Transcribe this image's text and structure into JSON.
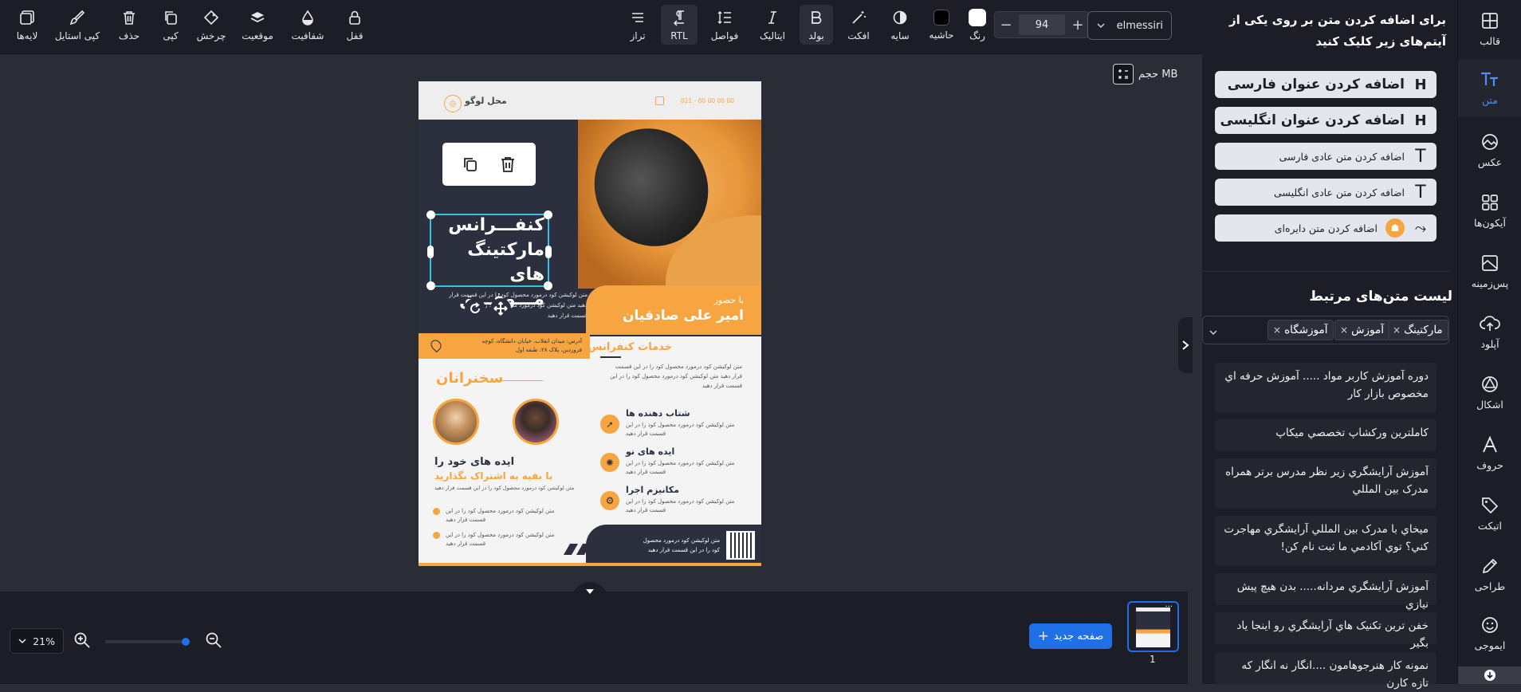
{
  "toolbar": {
    "font_name": "elmessiri",
    "font_size": "94",
    "minus": "−",
    "plus": "+",
    "items": {
      "color": "رنگ",
      "border": "حاشیه",
      "shadow": "سایه",
      "effect": "افکت",
      "bold": "بولد",
      "italic": "ایتالیک",
      "spacing": "فواصل",
      "rtl": "RTL",
      "align": "تراز",
      "lock": "قفل",
      "opacity": "شفافیت",
      "position": "موقعیت",
      "rotate": "چرخش",
      "copy": "کپی",
      "delete": "حذف",
      "copy_style": "کپی استایل",
      "layers": "لایه‌ها"
    }
  },
  "sidebar": {
    "items": [
      {
        "label": "قالب",
        "icon": "template-icon"
      },
      {
        "label": "متن",
        "icon": "text-icon"
      },
      {
        "label": "عکس",
        "icon": "image-icon"
      },
      {
        "label": "آیکون‌ها",
        "icon": "icons-grid-icon"
      },
      {
        "label": "پس‌زمینه",
        "icon": "background-icon"
      },
      {
        "label": "آپلود",
        "icon": "upload-icon"
      },
      {
        "label": "اشکال",
        "icon": "shapes-icon"
      },
      {
        "label": "حروف",
        "icon": "letters-icon"
      },
      {
        "label": "اتیکت",
        "icon": "tag-icon"
      },
      {
        "label": "طراحی",
        "icon": "draw-icon"
      },
      {
        "label": "ایموجی",
        "icon": "emoji-icon"
      }
    ]
  },
  "panel": {
    "instruction": "برای اضافه کردن متن بر روی یکی از آیتم‌های زیر کلیک کنید",
    "add_buttons": [
      {
        "label": "اضافه کردن عنوان فارسی",
        "glyph": "H"
      },
      {
        "label": "اضافه کردن عنوان انگلیسی",
        "glyph": "H"
      },
      {
        "label": "اضافه کردن متن عادی فارسی",
        "glyph": "T"
      },
      {
        "label": "اضافه کردن متن عادی انگلیسی",
        "glyph": "T"
      },
      {
        "label": "اضافه کردن متن دایره‌ای",
        "glyph": "⤳"
      }
    ],
    "related_title": "لیست متن‌های مرتبط",
    "chips": [
      "مارکتینگ",
      "آموزش",
      "آموزشگاه"
    ],
    "related": [
      "دوره آموزش کاربر مواد ..... آموزش حرفه اي مخصوص بازار کار",
      "کاملترین ورکشاپ تخصصي میکاپ",
      "آموزش آرایشگري زیر نظر مدرس برتر همراه مدرک بین المللي",
      "میخاي با مدرک بین المللي آرایشگري مهاجرت کني؟ توي آکادمي ما ثبت نام کن!",
      "آموزش آرایشگري مردانه..... بدن هیچ پیش نیازي",
      "خفن ترین تکنیک هاي آرایشگري رو اینجا یاد بگیر",
      "نمونه کار هنرجوهامون ....انگار نه انگار که تازه کارن"
    ]
  },
  "canvas": {
    "size_label": "حجم MB"
  },
  "poster": {
    "logo_place": "محل لوگو",
    "phone": "021 - 00 00 00 00",
    "headline_1": "کنفـــرانس",
    "headline_2": "مارکتینگ های",
    "headline_3": "مـــوفـــق",
    "lorem_line_1": "متن لوکیشن کود درمورد محصول کود را در این قسمت قرار",
    "lorem_line_2": "دهید  متن لوکیشن کود درمورد محصول کود را در این",
    "lorem_line_3": "قسمت قرار دهید",
    "with_presence": "با حضور",
    "speaker_name": "امیر علی صادقیان",
    "address_1": "آدرس: میدان انقلاب، خیابان دانشگاه، کوچه",
    "address_2": "فروردین، پلاک ۲۸، طبقه اول",
    "services_title": "خدمات کنفرانس",
    "services_text_1": "متن لوکیشن کود درمورد محصول کود را در این قسمت",
    "services_text_2": "قرار دهید  متن لوکیشن کود درمورد محصول کود را در این",
    "services_text_3": "قسمت قرار دهید",
    "speakers_title": "سخنرانان",
    "features": [
      {
        "title": "شتاب دهنده ها",
        "text": "متن لوکیشن کود درمورد محصول کود را در این"
      },
      {
        "title": "ایده های نو",
        "text": "متن لوکیشن کود درمورد محصول کود را در این"
      },
      {
        "title": "مکانیزم اجرا",
        "text": "متن لوکیشن کود درمورد محصول کود را در این"
      }
    ],
    "feature_sub": "قسمت قرار دهید",
    "idea_1": "ایده های خود را",
    "idea_2": "با بقیه به اشتراک بگذارید",
    "idea_text": "متن لوکیشن کود درمورد محصول کود را در این قسمت قرار دهید",
    "bullet_1": "متن لوکیشن کود درمورد محصول کود را در این",
    "bullet_sub": "قسمت قرار دهید",
    "bullet_2": "متن لوکیشن کود درمورد محصول کود را در این",
    "footer_1": "متن لوکیشن کود درمورد محصول",
    "footer_2": "کود را در این قسمت قرار دهید"
  },
  "bottom": {
    "zoom": "21%",
    "new_page": "صفحه جدید",
    "page_number": "1",
    "thumb_menu": "···"
  },
  "colors": {
    "accent": "#f7a541",
    "selection": "#35c0e8",
    "primary": "#1f6fe6",
    "dark": "#1c1d26",
    "navy": "#2c3040"
  }
}
